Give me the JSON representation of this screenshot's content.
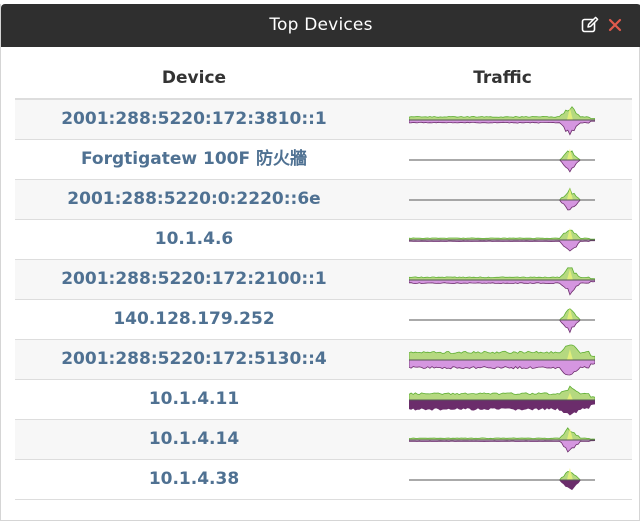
{
  "window": {
    "title": "Top Devices",
    "icons": {
      "edit": "edit-icon",
      "close": "close-icon"
    },
    "colors": {
      "titlebar": "#2f2f2f",
      "close": "#e05a4c",
      "link": "#4f7192"
    }
  },
  "table": {
    "headers": {
      "device": "Device",
      "traffic": "Traffic"
    },
    "colors": {
      "in_light": "#b5d980",
      "in_dark": "#5fae34",
      "out_light": "#d596e0",
      "out_dark": "#6b2d6b",
      "spike_light": "#e9f27a",
      "baseline": "#555555"
    },
    "rows": [
      {
        "device": "2001:288:5220:172:3810::1",
        "traffic": {
          "in_level": 0.35,
          "out_level": 0.3,
          "in_start": 0.0,
          "out_start": 0.0,
          "spike": 1.0,
          "dark_out": false
        }
      },
      {
        "device": "Forgtigatew 100F 防火牆",
        "traffic": {
          "in_level": 0.0,
          "out_level": 0.0,
          "in_start": 0.62,
          "out_start": 0.62,
          "spike": 0.95,
          "dark_out": false
        }
      },
      {
        "device": "2001:288:5220:0:2220::6e",
        "traffic": {
          "in_level": 0.0,
          "out_level": 0.0,
          "in_start": 0.95,
          "out_start": 0.95,
          "spike": 1.0,
          "dark_out": false
        }
      },
      {
        "device": "10.1.4.6",
        "traffic": {
          "in_level": 0.2,
          "out_level": 0.15,
          "in_start": 0.0,
          "out_start": 0.0,
          "spike": 1.0,
          "dark_out": false
        }
      },
      {
        "device": "2001:288:5220:172:2100::1",
        "traffic": {
          "in_level": 0.3,
          "out_level": 0.35,
          "in_start": 0.0,
          "out_start": 0.0,
          "spike": 0.9,
          "dark_out": false
        }
      },
      {
        "device": "140.128.179.252",
        "traffic": {
          "in_level": 0.0,
          "out_level": 0.0,
          "in_start": 0.82,
          "out_start": 0.82,
          "spike": 1.0,
          "dark_out": false
        }
      },
      {
        "device": "2001:288:5220:172:5130::4",
        "traffic": {
          "in_level": 0.85,
          "out_level": 0.85,
          "in_start": 0.0,
          "out_start": 0.0,
          "spike": 0.9,
          "dark_out": false
        }
      },
      {
        "device": "10.1.4.11",
        "traffic": {
          "in_level": 0.7,
          "out_level": 1.0,
          "in_start": 0.0,
          "out_start": 0.0,
          "spike": 0.6,
          "dark_out": true
        }
      },
      {
        "device": "10.1.4.14",
        "traffic": {
          "in_level": 0.2,
          "out_level": 0.15,
          "in_start": 0.0,
          "out_start": 0.0,
          "spike": 1.0,
          "dark_out": false
        }
      },
      {
        "device": "10.1.4.38",
        "traffic": {
          "in_level": 0.0,
          "out_level": 0.0,
          "in_start": 0.95,
          "out_start": 0.95,
          "spike": 1.0,
          "dark_out": true
        }
      }
    ]
  }
}
